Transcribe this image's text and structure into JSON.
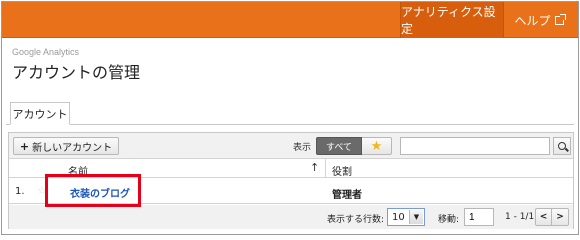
{
  "topbar": {
    "settings_label": "アナリティクス設定",
    "help_label": "ヘルプ",
    "accent_color": "#e8711a"
  },
  "header": {
    "brand": "Google Analytics",
    "title": "アカウントの管理"
  },
  "tabs": [
    {
      "label": "アカウント",
      "active": true
    }
  ],
  "toolbar": {
    "new_account_label": "新しいアカウント",
    "show_label": "表示",
    "filter_all_label": "すべて",
    "filter_star_icon": "star-icon",
    "search_placeholder": ""
  },
  "table": {
    "columns": [
      "名前",
      "役割"
    ],
    "sort_icon": "arrow-up-icon",
    "rows": [
      {
        "index": "1.",
        "name": "衣装のブログ",
        "role": "管理者"
      }
    ]
  },
  "footer": {
    "rows_label": "表示する行数:",
    "rows_value": "10",
    "goto_label": "移動:",
    "goto_value": "1",
    "range": "1 - 1/1",
    "prev_label": "<",
    "next_label": ">"
  },
  "highlight_color": "#e4001b"
}
